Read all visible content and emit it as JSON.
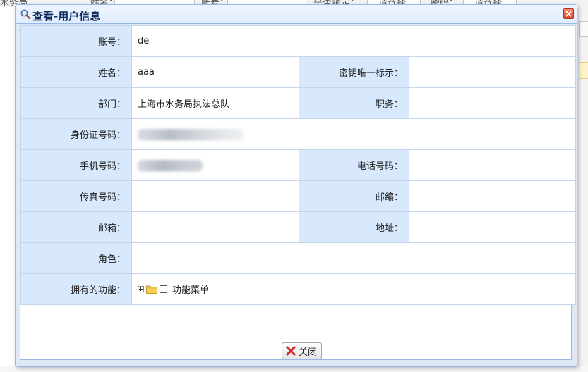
{
  "background": {
    "toolbar_labels": [
      "水务局",
      "姓名：",
      "账号：",
      "是否锁定：",
      "请选择",
      "密码：",
      "请选择"
    ]
  },
  "dialog": {
    "title": "查看-用户信息",
    "title_icon": "magnifier-icon",
    "close_icon": "close-icon"
  },
  "form": {
    "account_label": "账号：",
    "account_value": "de",
    "name_label": "姓名：",
    "name_value": "aaa",
    "key_label": "密钥唯一标示：",
    "key_value": "",
    "dept_label": "部门：",
    "dept_value": "上海市水务局执法总队",
    "duty_label": "职务：",
    "duty_value": "",
    "id_label": "身份证号码：",
    "mobile_label": "手机号码：",
    "phone_label": "电话号码：",
    "phone_value": "",
    "fax_label": "传真号码：",
    "fax_value": "",
    "zip_label": "邮编：",
    "zip_value": "",
    "email_label": "邮箱：",
    "email_value": "",
    "address_label": "地址：",
    "address_value": "",
    "role_label": "角色：",
    "role_value": "",
    "functions_label": "拥有的功能：",
    "functions_tree_root": "功能菜单"
  },
  "buttons": {
    "close_label": "关闭",
    "close_icon": "red-x-icon"
  },
  "colors": {
    "label_bg": "#d8e8fd",
    "border": "#95b8e7",
    "header_text": "#0e2d5f"
  }
}
